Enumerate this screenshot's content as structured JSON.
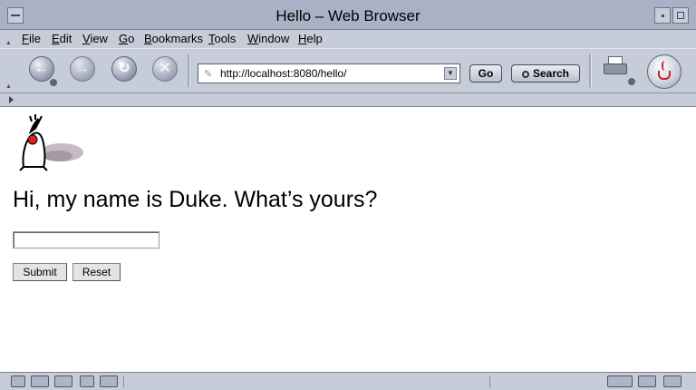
{
  "window": {
    "title": "Hello – Web Browser"
  },
  "menu": {
    "items": [
      {
        "label": "File"
      },
      {
        "label": "Edit"
      },
      {
        "label": "View"
      },
      {
        "label": "Go"
      },
      {
        "label": "Bookmarks"
      },
      {
        "label": "Tools"
      },
      {
        "label": "Window"
      },
      {
        "label": "Help"
      }
    ]
  },
  "nav": {
    "back_icon": "back-arrow-icon",
    "forward_icon": "forward-arrow-icon",
    "reload_icon": "reload-icon",
    "stop_icon": "stop-icon",
    "url": "http://localhost:8080/hello/",
    "go_label": "Go",
    "search_label": "Search"
  },
  "page": {
    "heading": "Hi, my name is Duke. What’s yours?",
    "name_field_value": "",
    "submit_label": "Submit",
    "reset_label": "Reset"
  },
  "status": {
    "text": ""
  },
  "colors": {
    "chrome": "#c6ccd8",
    "titlebar": "#a9b1c4"
  }
}
